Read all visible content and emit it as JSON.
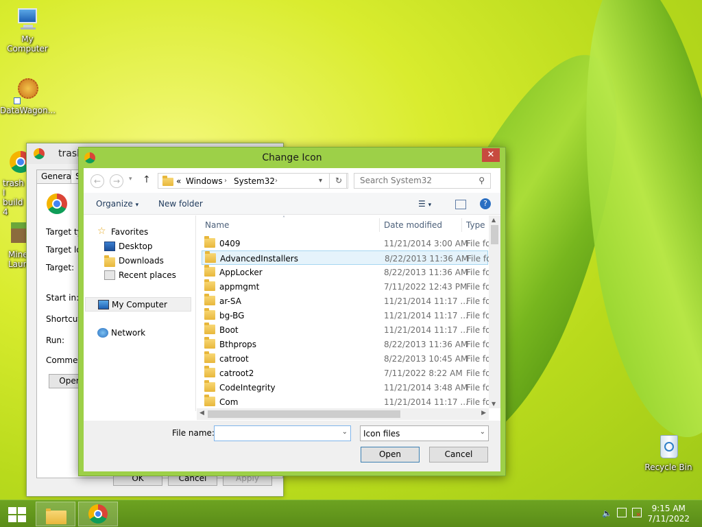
{
  "desktop": {
    "icons": [
      {
        "label": "My Computer"
      },
      {
        "label": "DataWagon..."
      },
      {
        "label": "trash I",
        "label2": "build 4"
      },
      {
        "label": "Mine",
        "label2": "Laun"
      },
      {
        "label": "Recycle Bin"
      }
    ]
  },
  "properties_window": {
    "title": "trash",
    "tabs": [
      "General",
      "S"
    ],
    "fields": [
      "Target ty",
      "Target lo",
      "Target:",
      "Start in:",
      "Shortcut",
      "Run:",
      "Commen"
    ],
    "open_button": "Oper",
    "buttons": {
      "ok": "OK",
      "cancel": "Cancel",
      "apply": "Apply"
    }
  },
  "dialog": {
    "title": "Change Icon",
    "close_glyph": "✕",
    "address": {
      "prefix": "«",
      "crumbs": [
        "Windows",
        "System32"
      ]
    },
    "search": {
      "placeholder": "Search System32"
    },
    "toolbar": {
      "organize": "Organize",
      "new_folder": "New folder"
    },
    "nav": {
      "favorites": "Favorites",
      "desktop": "Desktop",
      "downloads": "Downloads",
      "recent": "Recent places",
      "computer": "My Computer",
      "network": "Network"
    },
    "columns": {
      "name": "Name",
      "date": "Date modified",
      "type": "Type"
    },
    "files": [
      {
        "name": "0409",
        "date": "11/21/2014 3:00 AM",
        "type": "File fol"
      },
      {
        "name": "AdvancedInstallers",
        "date": "8/22/2013 11:36 AM",
        "type": "File fol"
      },
      {
        "name": "AppLocker",
        "date": "8/22/2013 11:36 AM",
        "type": "File fol"
      },
      {
        "name": "appmgmt",
        "date": "7/11/2022 12:43 PM",
        "type": "File fol"
      },
      {
        "name": "ar-SA",
        "date": "11/21/2014 11:17 ...",
        "type": "File fol"
      },
      {
        "name": "bg-BG",
        "date": "11/21/2014 11:17 ...",
        "type": "File fol"
      },
      {
        "name": "Boot",
        "date": "11/21/2014 11:17 ...",
        "type": "File fol"
      },
      {
        "name": "Bthprops",
        "date": "8/22/2013 11:36 AM",
        "type": "File fol"
      },
      {
        "name": "catroot",
        "date": "8/22/2013 10:45 AM",
        "type": "File fol"
      },
      {
        "name": "catroot2",
        "date": "7/11/2022 8:22 AM",
        "type": "File fol"
      },
      {
        "name": "CodeIntegrity",
        "date": "11/21/2014 3:48 AM",
        "type": "File fol"
      },
      {
        "name": "Com",
        "date": "11/21/2014 11:17 ...",
        "type": "File fol"
      }
    ],
    "selected_index": 1,
    "file_name_label": "File name:",
    "file_name_value": "",
    "file_type": "Icon files",
    "open_button": "Open",
    "cancel_button": "Cancel"
  },
  "taskbar": {
    "time": "9:15 AM",
    "date": "7/11/2022"
  }
}
